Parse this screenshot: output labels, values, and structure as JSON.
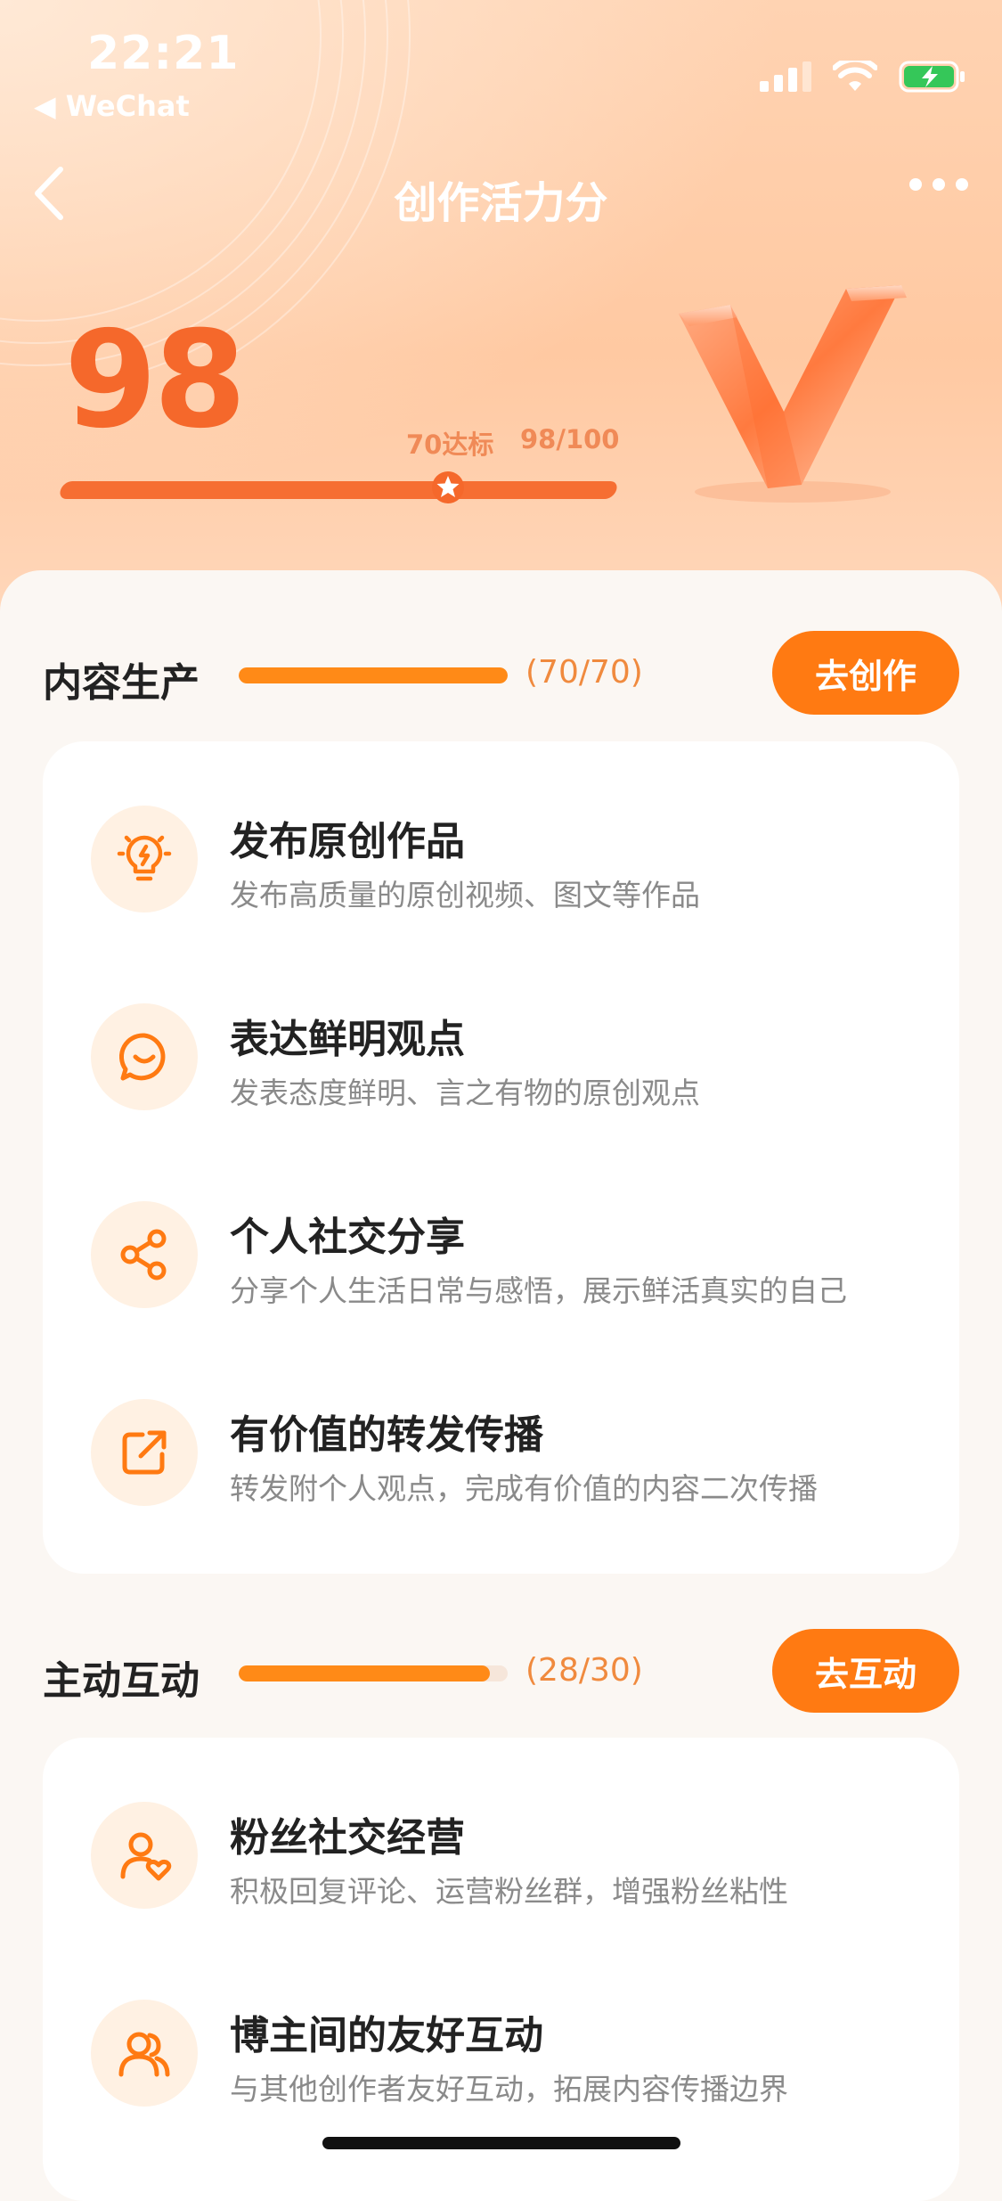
{
  "status_bar": {
    "time": "22:21",
    "back_app": "◀ WeChat"
  },
  "nav": {
    "title": "创作活力分"
  },
  "score": {
    "value": "98",
    "threshold_label": "70达标",
    "progress_label": "98/100",
    "progress": 0.98,
    "threshold": 0.7
  },
  "colors": {
    "accent": "#FF7A12",
    "score": "#F5682B",
    "icon_bg": "#FFF1E3"
  },
  "sections": [
    {
      "title": "内容生产",
      "count": "(70/70)",
      "progress": 1.0,
      "button": "去创作",
      "items": [
        {
          "icon": "lightbulb-icon",
          "title": "发布原创作品",
          "desc": "发布高质量的原创视频、图文等作品"
        },
        {
          "icon": "chat-smile-icon",
          "title": "表达鲜明观点",
          "desc": "发表态度鲜明、言之有物的原创观点"
        },
        {
          "icon": "share-icon",
          "title": "个人社交分享",
          "desc": "分享个人生活日常与感悟，展示鲜活真实的自己"
        },
        {
          "icon": "forward-icon",
          "title": "有价值的转发传播",
          "desc": "转发附个人观点，完成有价值的内容二次传播"
        }
      ]
    },
    {
      "title": "主动互动",
      "count": "(28/30)",
      "progress": 0.933,
      "button": "去互动",
      "items": [
        {
          "icon": "user-heart-icon",
          "title": "粉丝社交经营",
          "desc": "积极回复评论、运营粉丝群，增强粉丝粘性"
        },
        {
          "icon": "users-icon",
          "title": "博主间的友好互动",
          "desc": "与其他创作者友好互动，拓展内容传播边界"
        }
      ]
    }
  ]
}
